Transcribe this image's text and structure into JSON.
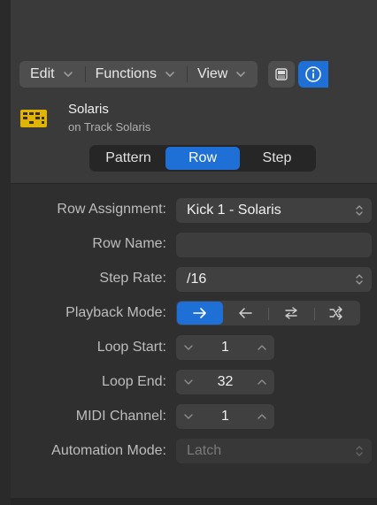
{
  "toolbar": {
    "edit_label": "Edit",
    "functions_label": "Functions",
    "view_label": "View"
  },
  "region": {
    "name": "Solaris",
    "subtitle": "on Track Solaris"
  },
  "tabs": [
    {
      "label": "Pattern",
      "active": false
    },
    {
      "label": "Row",
      "active": true
    },
    {
      "label": "Step",
      "active": false
    }
  ],
  "form": {
    "row_assignment": {
      "label": "Row Assignment:",
      "value": "Kick 1 - Solaris"
    },
    "row_name": {
      "label": "Row Name:",
      "value": ""
    },
    "step_rate": {
      "label": "Step Rate:",
      "value": "/16"
    },
    "playback_mode": {
      "label": "Playback Mode:",
      "options": [
        "forward-arrow-icon",
        "backward-arrow-icon",
        "ping-pong-icon",
        "random-icon"
      ],
      "selected": 0
    },
    "loop_start": {
      "label": "Loop Start:",
      "value": "1"
    },
    "loop_end": {
      "label": "Loop End:",
      "value": "32"
    },
    "midi_channel": {
      "label": "MIDI Channel:",
      "value": "1"
    },
    "automation_mode": {
      "label": "Automation Mode:",
      "value": "Latch",
      "enabled": false
    }
  },
  "colors": {
    "accent": "#1e6fd6",
    "pattern_icon": "#e0b400"
  }
}
